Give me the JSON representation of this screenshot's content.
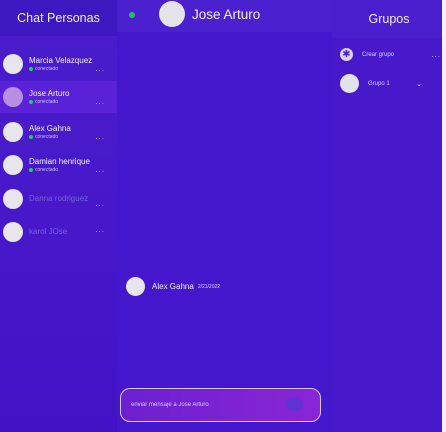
{
  "sidebar": {
    "title": "Chat Personas",
    "contacts": [
      {
        "name": "Marcia Velazquez",
        "status": "conectado",
        "more": "..."
      },
      {
        "name": "Jose Arturo",
        "status": "conectado",
        "more": "..."
      },
      {
        "name": "Alex Gahna",
        "status": "conectado",
        "more": "..."
      },
      {
        "name": "Damian henrique",
        "status": "conectado",
        "more": "..."
      },
      {
        "name": "Danna rodriguez",
        "more": "..."
      },
      {
        "name": "karol JOse",
        "more": "..."
      }
    ]
  },
  "chat": {
    "contact_name": "Jose Arturo",
    "message": {
      "sender": "Alex Gahna",
      "date": "2/21/2022"
    },
    "composer": {
      "placeholder": "enviar mensaje a Jose Arturo"
    }
  },
  "groups": {
    "title": "Grupos",
    "create_label": "Crear grupo",
    "create_more": "...",
    "items": [
      {
        "name": "Grupo 1",
        "chevron": "⌄"
      }
    ]
  },
  "colors": {
    "online": "#1cc84f",
    "background": "#4416cc"
  }
}
